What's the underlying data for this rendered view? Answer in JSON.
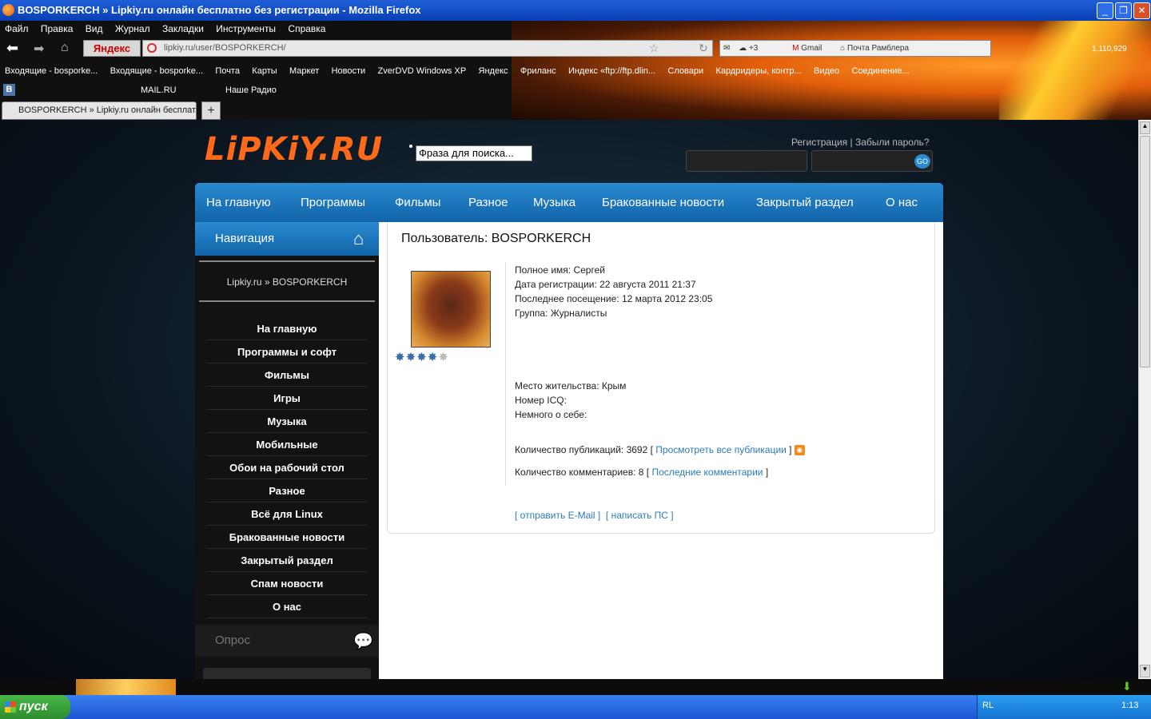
{
  "window": {
    "title": "BOSPORKERCH » Lipkiy.ru онлайн бесплатно без регистрации - Mozilla Firefox"
  },
  "menu": [
    "Файл",
    "Правка",
    "Вид",
    "Журнал",
    "Закладки",
    "Инструменты",
    "Справка"
  ],
  "toolbar": {
    "search_engine": "Яндекс",
    "url": "lipkiy.ru/user/BOSPORKERCH/",
    "mail_count": "+3",
    "gmail": "Gmail",
    "rambler": "Почта Рамблера",
    "visits": "1,110,929"
  },
  "bookmarks": [
    "Входящие - bosporke...",
    "Входящие - bosporke...",
    "Почта",
    "Карты",
    "Маркет",
    "Новости",
    "ZverDVD Windows XP",
    "Яндекс",
    "Фриланс",
    "Индекс «ftp://ftp.dlin...",
    "Словари",
    "Кардридеры, контр...",
    "Видео",
    "Соединение..."
  ],
  "toolbar2": {
    "mailru": "MAIL.RU",
    "radio": "Наше Радио"
  },
  "tab": {
    "label": "BOSPORKERCH » Lipkiy.ru онлайн бесплат..."
  },
  "site": {
    "logo": "LiPKiY.RU",
    "search_placeholder": "Фраза для поиска...",
    "register": "Регистрация",
    "forgot": "Забыли пароль?",
    "go": "GO",
    "nav": [
      "На главную",
      "Программы",
      "Фильмы",
      "Разное",
      "Музыка",
      "Бракованные новости",
      "Закрытый раздел",
      "О нас"
    ],
    "sidebar": {
      "title": "Навигация",
      "breadcrumb": "Lipkiy.ru » BOSPORKERCH",
      "items": [
        "На главную",
        "Программы и софт",
        "Фильмы",
        "Игры",
        "Музыка",
        "Мобильные",
        "Обои на рабочий стол",
        "Разное",
        "Всё для Linux",
        "Бракованные новости",
        "Закрытый раздел",
        "Спам новости",
        "О нас"
      ],
      "poll": "Опрос"
    },
    "profile": {
      "heading": "Пользователь: BOSPORKERCH",
      "fullname": "Полное имя: Сергей",
      "registered": "Дата регистрации: 22 августа 2011 21:37",
      "last_visit": "Последнее посещение: 12 марта 2012 23:05",
      "group": "Группа: Журналисты",
      "location": "Место жительства: Крым",
      "icq": "Номер ICQ:",
      "about": "Немного о себе:",
      "pubs": "Количество публикаций: 3692 [",
      "pubs_link": "Просмотреть все публикации",
      "comments": "Количество комментариев: 8 [",
      "comments_link": "Последние комментарии",
      "email_link": "[ отправить E-Mail ]",
      "pm_link": "[ написать ПС ]",
      "rating": 4,
      "rating_max": 5
    }
  },
  "taskbar": {
    "start": "пуск",
    "lang": "RL",
    "time": "1:13"
  }
}
